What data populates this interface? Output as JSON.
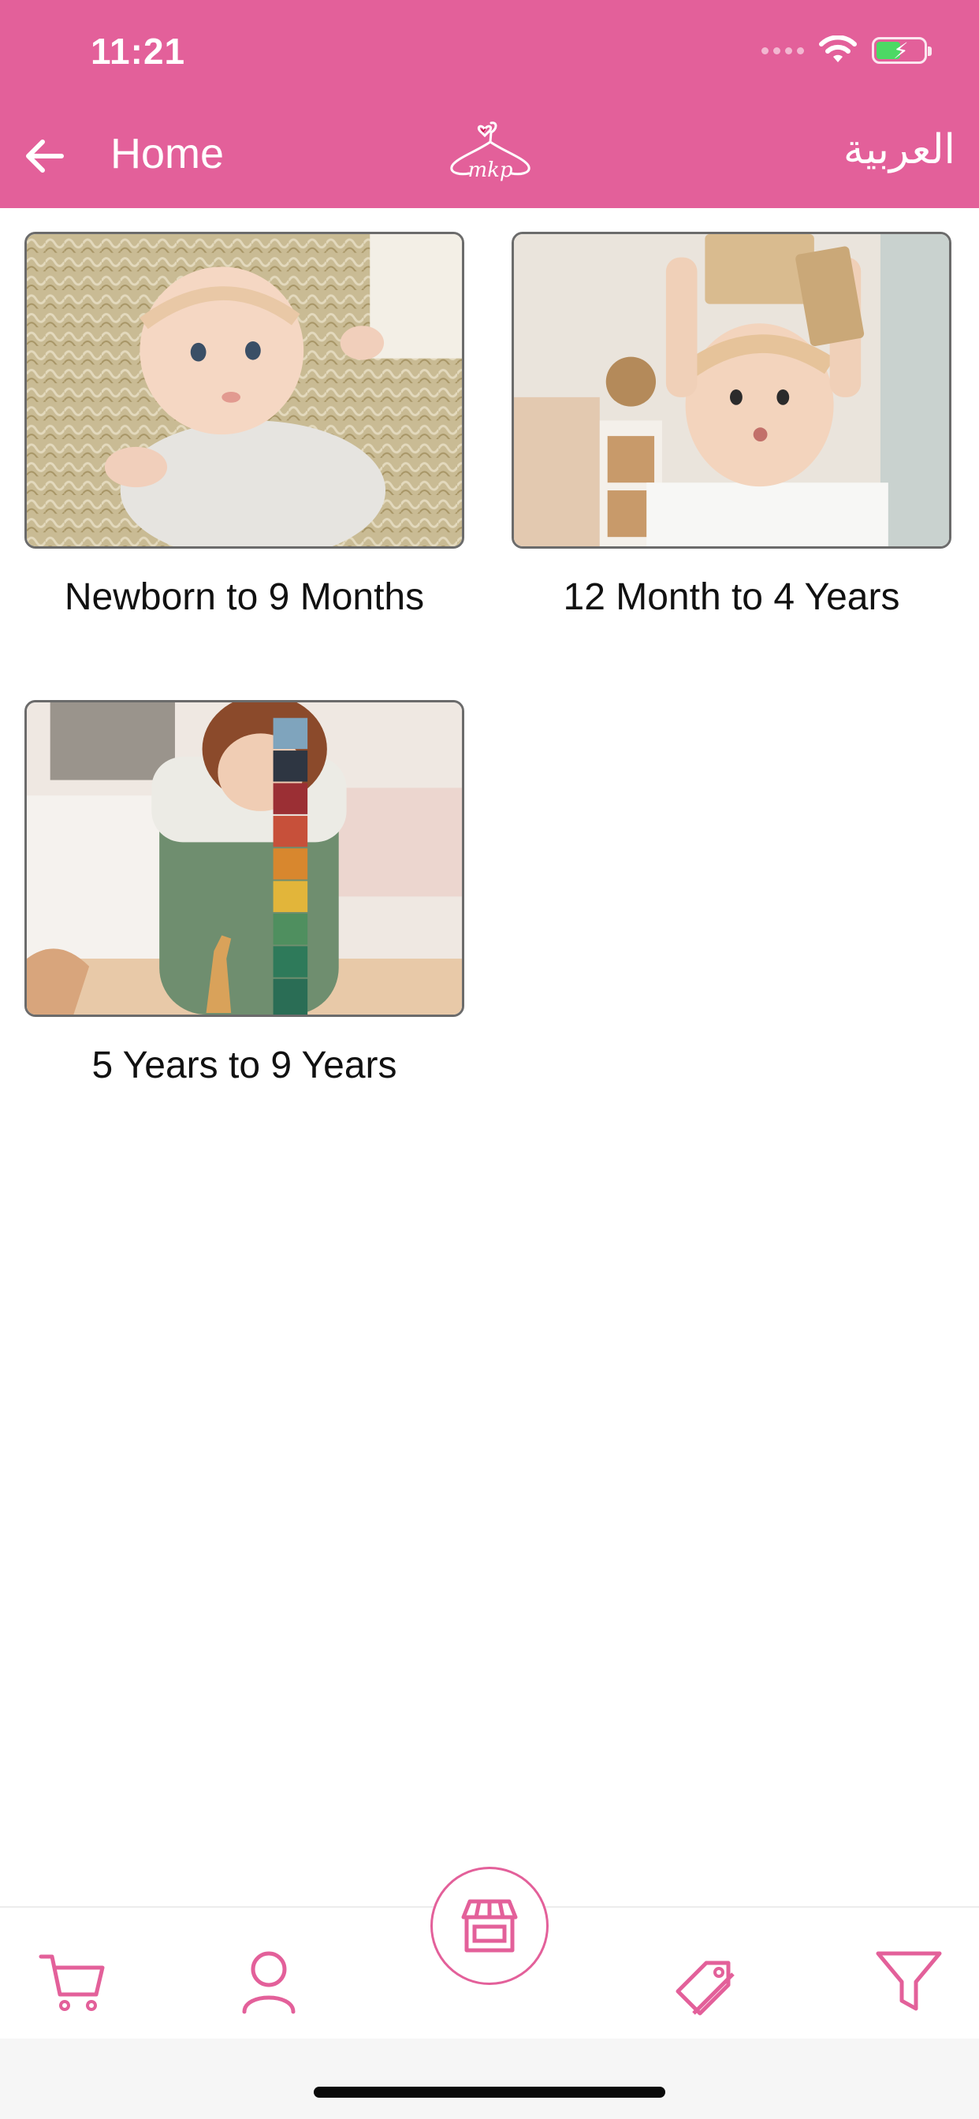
{
  "status_bar": {
    "time": "11:21"
  },
  "header": {
    "back_icon": "arrow-left-icon",
    "title": "Home",
    "logo_text": "mkp",
    "language_toggle": "العربية"
  },
  "categories": [
    {
      "label": "Newborn to 9 Months",
      "image": "baby-lying-on-fur-rug"
    },
    {
      "label": "12 Month to 4 Years",
      "image": "toddler-holding-wooden-blocks"
    },
    {
      "label": "5 Years to 9 Years",
      "image": "child-stacking-color-blocks"
    }
  ],
  "tabbar": {
    "items": [
      "cart-icon",
      "user-icon",
      "store-icon",
      "tag-icon",
      "filter-icon"
    ]
  },
  "colors": {
    "brand": "#e3609a",
    "text": "#111111"
  }
}
